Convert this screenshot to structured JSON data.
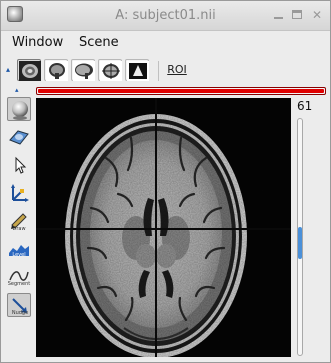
{
  "window": {
    "title": "A: subject01.nii",
    "controls": {
      "minimize_icon": "minimize-icon",
      "maximize_icon": "maximize-icon",
      "close_icon": "close-icon"
    }
  },
  "menubar": {
    "items": [
      {
        "label": "Window"
      },
      {
        "label": "Scene"
      }
    ]
  },
  "toolbar": {
    "view_buttons": [
      {
        "icon": "axial-view-icon"
      },
      {
        "icon": "coronal-view-icon"
      },
      {
        "icon": "sagittal-view-icon"
      },
      {
        "icon": "multiplanar-view-icon"
      },
      {
        "icon": "render-view-icon"
      }
    ],
    "roi_label": "ROI"
  },
  "progress": {
    "fraction": 1.0,
    "color": "#e00000"
  },
  "left_tools": [
    {
      "icon": "sphere-tool-icon",
      "caption": "",
      "active": true
    },
    {
      "icon": "surface-tool-icon",
      "caption": ""
    },
    {
      "icon": "pointer-tool-icon",
      "caption": ""
    },
    {
      "icon": "axes-tool-icon",
      "caption": ""
    },
    {
      "icon": "draw-tool-icon",
      "caption": "Draw"
    },
    {
      "icon": "level-tool-icon",
      "caption": "Level"
    },
    {
      "icon": "segment-tool-icon",
      "caption": "Segment"
    },
    {
      "icon": "nudge-tool-icon",
      "caption": "Nudge",
      "active": true
    }
  ],
  "slice": {
    "value": "61",
    "fraction": 0.53,
    "accent": "#4a90d9"
  }
}
